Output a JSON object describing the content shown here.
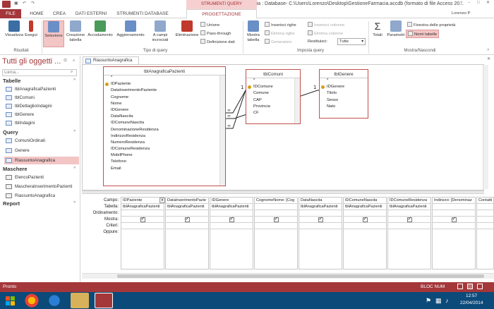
{
  "window": {
    "title": "GestioneFarmacia : Database- C:\\Users\\Lorenzo\\Desktop\\GestioneFarmacia.accdb (formato di file Access 20...",
    "contextual_header": "STRUMENTI QUERY",
    "user": "Lorenzo P",
    "help": "?"
  },
  "tabs": {
    "file": "FILE",
    "home": "HOME",
    "crea": "CREA",
    "dati_esterni": "DATI ESTERNI",
    "strumenti_db": "STRUMENTI DATABASE",
    "progettazione": "PROGETTAZIONE"
  },
  "ribbon": {
    "visualizza": "Visualizza",
    "esegui": "Esegui",
    "risultati": "Risultati",
    "selezione": "Selezione",
    "creazione_tabella": "Creazione tabella",
    "accodamento": "Accodamento",
    "aggiornamento": "Aggiornamento",
    "campi_incrociati": "A campi incrociati",
    "eliminazione": "Eliminazione",
    "unione": "Unione",
    "pass_through": "Pass-through",
    "definizione_dati": "Definizione dati",
    "tipo_query": "Tipo di query",
    "mostra_tabella": "Mostra tabella",
    "inserisci_righe": "Inserisci righe",
    "elimina_righe": "Elimina righe",
    "generatore": "Generatore",
    "inserisci_colonne": "Inserisci colonne",
    "elimina_colonne": "Elimina colonne",
    "restituisci": "Restituisci:",
    "restituisci_val": "Tutte",
    "imposta_query": "Imposta query",
    "totali": "Totali",
    "parametri": "Parametri",
    "finestra_proprieta": "Finestra delle proprietà",
    "nomi_tabelle": "Nomi tabelle",
    "mostra_nascondi": "Mostra/Nascondi"
  },
  "nav": {
    "title": "Tutti gli oggetti ...",
    "search_placeholder": "Cerca...",
    "sections": [
      {
        "label": "Tabelle",
        "items": [
          "tblAnagraficaPazienti",
          "tblComuni",
          "tblDettaglioIndagini",
          "tblGenere",
          "tblIndagini"
        ]
      },
      {
        "label": "Query",
        "items": [
          "ComuniOrdinati",
          "Genere",
          "RiassuntoAnagrafica"
        ]
      },
      {
        "label": "Maschere",
        "items": [
          "ElencoPazienti",
          "MascheraInserimentoPazienti",
          "RiassuntoAnagrafica"
        ]
      },
      {
        "label": "Report",
        "items": []
      }
    ]
  },
  "doc_tab": "RiassuntoAnagrafica",
  "tables": {
    "anagrafica": {
      "name": "tblAnagraficaPazienti",
      "fields": [
        "*",
        "IDPaziente",
        "DataInserimentoPaziente",
        "Cognome",
        "Nome",
        "IDGenere",
        "DataNascita",
        "IDComuneNascita",
        "DenominazioneResidenza",
        "IndirizzoResidenza",
        "NumeroResidenza",
        "IDComuneResidenza",
        "MobilPhone",
        "Telefono",
        "Email"
      ]
    },
    "comuni": {
      "name": "tblComuni",
      "fields": [
        "*",
        "IDComune",
        "Comune",
        "CAP",
        "Provincia",
        "CF"
      ]
    },
    "genere": {
      "name": "tblGenere",
      "fields": [
        "*",
        "IDGenere",
        "Titolo",
        "Sesso",
        "Nato"
      ]
    }
  },
  "grid": {
    "row_labels": [
      "Campo:",
      "Tabella:",
      "Ordinamento:",
      "Mostra:",
      "Criteri:",
      "Oppure:"
    ],
    "columns": [
      {
        "campo": "IDPaziente",
        "tabella": "tblAnagraficaPazienti",
        "mostra": true
      },
      {
        "campo": "DataInserimentoPazie",
        "tabella": "tblAnagraficaPazienti",
        "mostra": true
      },
      {
        "campo": "IDGenere",
        "tabella": "tblAnagraficaPazienti",
        "mostra": true
      },
      {
        "campo": "CognomeNome: [Cog",
        "tabella": "",
        "mostra": true
      },
      {
        "campo": "DataNascita",
        "tabella": "tblAnagraficaPazienti",
        "mostra": true
      },
      {
        "campo": "IDComuneNascita",
        "tabella": "tblAnagraficaPazienti",
        "mostra": true
      },
      {
        "campo": "IDComuneResidenza",
        "tabella": "tblAnagraficaPazienti",
        "mostra": true
      },
      {
        "campo": "Indirizzo: [Denominaz",
        "tabella": "",
        "mostra": true
      },
      {
        "campo": "Contatti",
        "tabella": "",
        "mostra": false
      }
    ]
  },
  "status": {
    "left": "Pronto",
    "right": "BLOC NUM"
  },
  "taskbar": {
    "time": "12:57",
    "date": "22/04/2014"
  }
}
